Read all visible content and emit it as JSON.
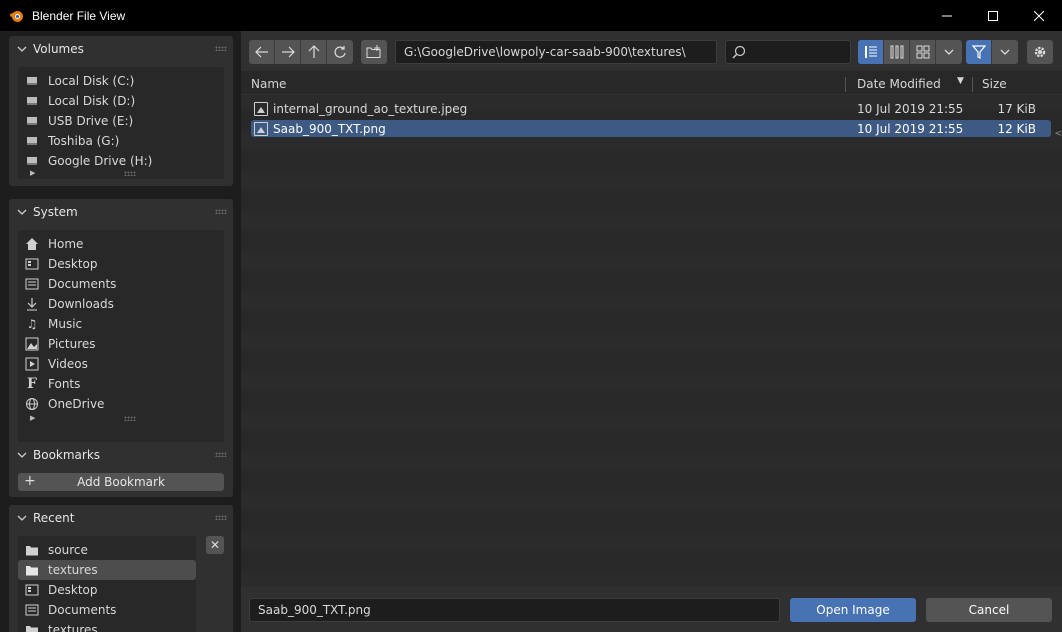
{
  "window": {
    "title": "Blender File View"
  },
  "sidebar": {
    "volumes": {
      "title": "Volumes",
      "items": [
        {
          "label": "Local Disk (C:)",
          "icon": "disk-icon"
        },
        {
          "label": "Local Disk (D:)",
          "icon": "disk-icon"
        },
        {
          "label": "USB Drive (E:)",
          "icon": "disk-icon"
        },
        {
          "label": "Toshiba (G:)",
          "icon": "disk-icon"
        },
        {
          "label": "Google Drive (H:)",
          "icon": "disk-icon"
        }
      ]
    },
    "system": {
      "title": "System",
      "items": [
        {
          "label": "Home",
          "icon": "home-icon"
        },
        {
          "label": "Desktop",
          "icon": "desktop-icon"
        },
        {
          "label": "Documents",
          "icon": "documents-icon"
        },
        {
          "label": "Downloads",
          "icon": "downloads-icon"
        },
        {
          "label": "Music",
          "icon": "music-icon"
        },
        {
          "label": "Pictures",
          "icon": "pictures-icon"
        },
        {
          "label": "Videos",
          "icon": "videos-icon"
        },
        {
          "label": "Fonts",
          "icon": "fonts-icon"
        },
        {
          "label": "OneDrive",
          "icon": "globe-icon"
        }
      ]
    },
    "bookmarks": {
      "title": "Bookmarks",
      "add_label": "Add Bookmark"
    },
    "recent": {
      "title": "Recent",
      "items": [
        {
          "label": "source",
          "icon": "folder-icon"
        },
        {
          "label": "textures",
          "icon": "folder-icon",
          "active": true
        },
        {
          "label": "Desktop",
          "icon": "desktop-icon"
        },
        {
          "label": "Documents",
          "icon": "documents-icon"
        },
        {
          "label": "textures",
          "icon": "folder-icon"
        }
      ]
    }
  },
  "toolbar": {
    "path": "G:\\GoogleDrive\\lowpoly-car-saab-900\\textures\\",
    "search_placeholder": ""
  },
  "columns": {
    "name": "Name",
    "date": "Date Modified",
    "size": "Size"
  },
  "files": [
    {
      "name": "internal_ground_ao_texture.jpeg",
      "date": "10 Jul 2019 21:55",
      "size": "17 KiB",
      "selected": false
    },
    {
      "name": "Saab_900_TXT.png",
      "date": "10 Jul 2019 21:55",
      "size": "12 KiB",
      "selected": true
    }
  ],
  "footer": {
    "filename": "Saab_900_TXT.png",
    "open_label": "Open Image",
    "cancel_label": "Cancel"
  },
  "colors": {
    "accent": "#4772b3",
    "selected_row": "#3d5a85"
  }
}
